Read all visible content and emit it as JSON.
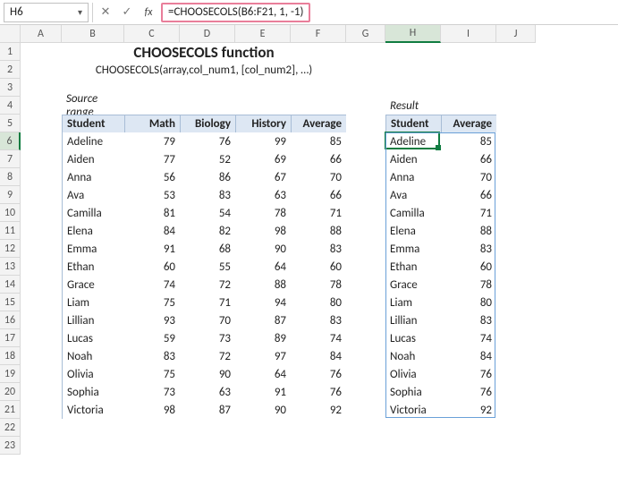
{
  "chart_data": {
    "type": "table",
    "title": "CHOOSECOLS function",
    "columns": [
      "Student",
      "Math",
      "Biology",
      "History",
      "Average"
    ],
    "rows": [
      [
        "Adeline",
        79,
        76,
        99,
        85
      ],
      [
        "Aiden",
        77,
        52,
        69,
        66
      ],
      [
        "Anna",
        56,
        86,
        67,
        70
      ],
      [
        "Ava",
        53,
        83,
        63,
        66
      ],
      [
        "Camilla",
        81,
        54,
        78,
        71
      ],
      [
        "Elena",
        84,
        82,
        98,
        88
      ],
      [
        "Emma",
        91,
        68,
        90,
        83
      ],
      [
        "Ethan",
        60,
        55,
        64,
        60
      ],
      [
        "Grace",
        74,
        72,
        88,
        78
      ],
      [
        "Liam",
        75,
        71,
        94,
        80
      ],
      [
        "Lillian",
        93,
        70,
        87,
        83
      ],
      [
        "Lucas",
        59,
        73,
        89,
        74
      ],
      [
        "Noah",
        83,
        72,
        97,
        84
      ],
      [
        "Olivia",
        75,
        90,
        64,
        76
      ],
      [
        "Sophia",
        73,
        63,
        91,
        76
      ],
      [
        "Victoria",
        98,
        87,
        90,
        92
      ]
    ],
    "result_columns": [
      "Student",
      "Average"
    ],
    "formula": "=CHOOSECOLS(B6:F21, 1, -1)"
  },
  "fbar": {
    "namebox": "H6",
    "cancel": "✕",
    "accept": "✓",
    "fx": "fx",
    "formula": "=CHOOSECOLS(B6:F21, 1, -1)"
  },
  "cols": [
    "A",
    "B",
    "C",
    "D",
    "E",
    "F",
    "G",
    "H",
    "I",
    "J"
  ],
  "title": "CHOOSECOLS function",
  "syntax": "CHOOSECOLS(array,col_num1, [col_num2], …)",
  "labels": {
    "source": "Source range",
    "result": "Result"
  },
  "headers": {
    "student": "Student",
    "math": "Math",
    "biology": "Biology",
    "history": "History",
    "average": "Average"
  },
  "rows": [
    {
      "n": "Adeline",
      "m": "79",
      "b": "76",
      "h": "99",
      "a": "85"
    },
    {
      "n": "Aiden",
      "m": "77",
      "b": "52",
      "h": "69",
      "a": "66"
    },
    {
      "n": "Anna",
      "m": "56",
      "b": "86",
      "h": "67",
      "a": "70"
    },
    {
      "n": "Ava",
      "m": "53",
      "b": "83",
      "h": "63",
      "a": "66"
    },
    {
      "n": "Camilla",
      "m": "81",
      "b": "54",
      "h": "78",
      "a": "71"
    },
    {
      "n": "Elena",
      "m": "84",
      "b": "82",
      "h": "98",
      "a": "88"
    },
    {
      "n": "Emma",
      "m": "91",
      "b": "68",
      "h": "90",
      "a": "83"
    },
    {
      "n": "Ethan",
      "m": "60",
      "b": "55",
      "h": "64",
      "a": "60"
    },
    {
      "n": "Grace",
      "m": "74",
      "b": "72",
      "h": "88",
      "a": "78"
    },
    {
      "n": "Liam",
      "m": "75",
      "b": "71",
      "h": "94",
      "a": "80"
    },
    {
      "n": "Lillian",
      "m": "93",
      "b": "70",
      "h": "87",
      "a": "83"
    },
    {
      "n": "Lucas",
      "m": "59",
      "b": "73",
      "h": "89",
      "a": "74"
    },
    {
      "n": "Noah",
      "m": "83",
      "b": "72",
      "h": "97",
      "a": "84"
    },
    {
      "n": "Olivia",
      "m": "75",
      "b": "90",
      "h": "64",
      "a": "76"
    },
    {
      "n": "Sophia",
      "m": "73",
      "b": "63",
      "h": "91",
      "a": "76"
    },
    {
      "n": "Victoria",
      "m": "98",
      "b": "87",
      "h": "90",
      "a": "92"
    }
  ]
}
